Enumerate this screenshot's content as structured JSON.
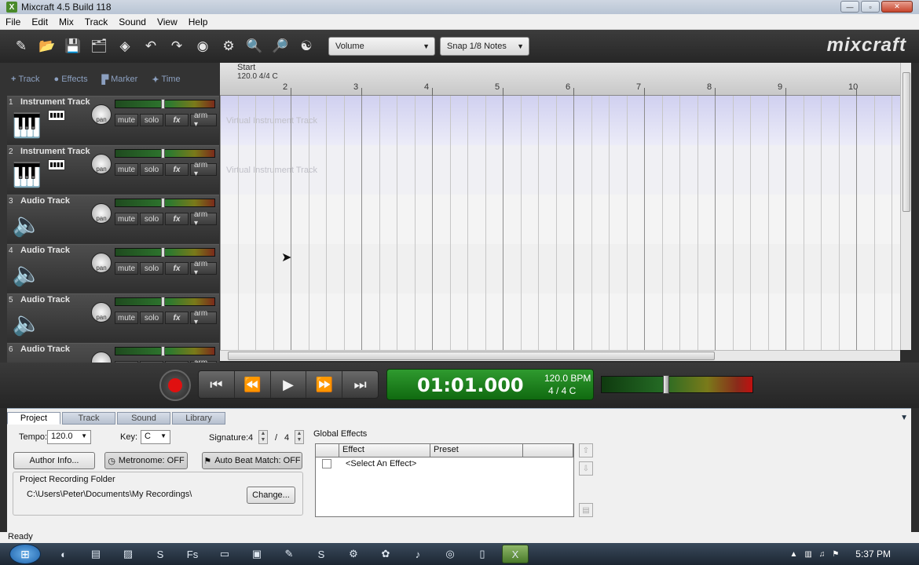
{
  "window": {
    "title": "Mixcraft 4.5 Build 118",
    "app_icon": "X",
    "controls": {
      "minimize": "—",
      "maximize": "▫",
      "close": "✕"
    }
  },
  "menu": [
    "File",
    "Edit",
    "Mix",
    "Track",
    "Sound",
    "View",
    "Help"
  ],
  "toolbar": {
    "icons": [
      "new-project-icon",
      "open-project-icon",
      "save-icon",
      "folder-icon",
      "library-icon",
      "undo-icon",
      "redo-icon",
      "metronome-icon",
      "snap-icon",
      "zoom-in-icon",
      "zoom-out-icon",
      "yin-yang-icon"
    ],
    "glyphs": [
      "✎",
      "📂",
      "💾",
      "🗂",
      "◈",
      "↶",
      "↷",
      "◉",
      "⚙",
      "🔍",
      "🔎",
      "☯"
    ],
    "view_dropdown": "Volume",
    "snap_dropdown": "Snap 1/8 Notes",
    "logo": "mixcraft"
  },
  "track_tabs": [
    {
      "icon": "+",
      "label": "Track"
    },
    {
      "icon": "●",
      "label": "Effects"
    },
    {
      "icon": "▛",
      "label": "Marker"
    },
    {
      "icon": "✦",
      "label": "Time"
    }
  ],
  "tracks": [
    {
      "num": "1",
      "name": "Instrument Track",
      "type": "instrument",
      "icon": "keyboard-icon",
      "glyph": "🎹"
    },
    {
      "num": "2",
      "name": "Instrument Track",
      "type": "instrument",
      "icon": "keyboard-icon",
      "glyph": "🎹"
    },
    {
      "num": "3",
      "name": "Audio Track",
      "type": "audio",
      "icon": "speaker-icon",
      "glyph": "🔈"
    },
    {
      "num": "4",
      "name": "Audio Track",
      "type": "audio",
      "icon": "speaker-icon",
      "glyph": "🔈"
    },
    {
      "num": "5",
      "name": "Audio Track",
      "type": "audio",
      "icon": "speaker-icon",
      "glyph": "🔈"
    },
    {
      "num": "6",
      "name": "Audio Track",
      "type": "audio",
      "icon": "speaker-icon",
      "glyph": "🔈"
    }
  ],
  "track_controls": {
    "pan": "pan",
    "mute": "mute",
    "solo": "solo",
    "fx": "fx",
    "arm": "arm ▾",
    "keys": "▮▮▮▮"
  },
  "timeline": {
    "start_label": "Start",
    "tempo_label": "120.0 4/4 C",
    "bars": [
      "2",
      "3",
      "4",
      "5",
      "6",
      "7",
      "8",
      "9",
      "10"
    ],
    "lane_label": "Virtual Instrument Track"
  },
  "transport": {
    "time": "01:01.000",
    "bpm": "120.0 BPM",
    "signature": "4 / 4   C"
  },
  "project_tabs": [
    "Project",
    "Track",
    "Sound",
    "Library"
  ],
  "project": {
    "tempo_label": "Tempo:",
    "tempo_value": "120.0",
    "key_label": "Key:",
    "key_value": "C",
    "signature_label": "Signature:",
    "sig_top": "4",
    "sig_slash": "/",
    "sig_bottom": "4",
    "author_button": "Author Info...",
    "metronome_button": "Metronome: OFF",
    "beat_match_button": "Auto Beat Match: OFF",
    "folder_label": "Project Recording Folder",
    "folder_path": "C:\\Users\\Peter\\Documents\\My Recordings\\",
    "change_button": "Change..."
  },
  "global_effects": {
    "label": "Global Effects",
    "columns": [
      "Effect",
      "Preset"
    ],
    "rows": [
      {
        "effect": "<Select An Effect>",
        "preset": ""
      }
    ]
  },
  "status": "Ready",
  "taskbar": {
    "icons": [
      "firefox-icon",
      "notes-icon",
      "stripes-icon",
      "s-icon",
      "fs-icon",
      "explorer-icon",
      "app-blue-icon",
      "pen-icon",
      "skype-icon",
      "gear-icon",
      "paint-icon",
      "media-icon",
      "chrome-icon",
      "document-icon",
      "mixcraft-icon"
    ],
    "glyphs": [
      "◐",
      "▤",
      "▨",
      "S",
      "Fs",
      "▭",
      "▣",
      "✎",
      "S",
      "⚙",
      "✿",
      "♪",
      "◎",
      "▯",
      "X"
    ],
    "clock": "5:37 PM"
  },
  "colors": {
    "record": "#e01010",
    "time_display": "#1f8a1f",
    "lane_highlight": "#d0d0f0"
  }
}
